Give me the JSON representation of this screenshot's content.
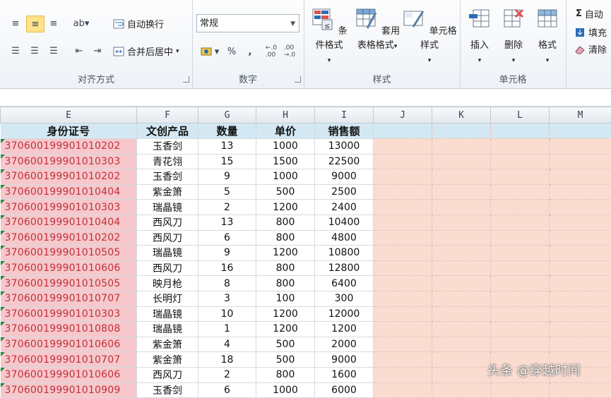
{
  "ribbon": {
    "alignment": {
      "title": "对齐方式",
      "wrap_text": "自动换行",
      "merge_center": "合并后居中"
    },
    "number": {
      "title": "数字",
      "format_value": "常规",
      "percent": "%",
      "comma": ","
    },
    "styles": {
      "title": "样式",
      "conditional": "条件格式",
      "table_format_1": "套用",
      "table_format_2": "表格格式",
      "cell_styles": "单元格样式"
    },
    "cells": {
      "title": "单元格",
      "insert": "插入",
      "delete": "删除",
      "format": "格式"
    },
    "editing": {
      "autosum": "自动",
      "fill": "填充",
      "clear": "清除"
    }
  },
  "columns": [
    "E",
    "F",
    "G",
    "H",
    "I",
    "J",
    "K",
    "L",
    "M"
  ],
  "table": {
    "headers": [
      "身份证号",
      "文创产品",
      "数量",
      "单价",
      "销售额"
    ],
    "rows": [
      [
        "370600199901010202",
        "玉香剑",
        "13",
        "1000",
        "13000"
      ],
      [
        "370600199901010303",
        "青花翎",
        "15",
        "1500",
        "22500"
      ],
      [
        "370600199901010202",
        "玉香剑",
        "9",
        "1000",
        "9000"
      ],
      [
        "370600199901010404",
        "紫金箫",
        "5",
        "500",
        "2500"
      ],
      [
        "370600199901010303",
        "瑞晶镜",
        "2",
        "1200",
        "2400"
      ],
      [
        "370600199901010404",
        "西风刀",
        "13",
        "800",
        "10400"
      ],
      [
        "370600199901010202",
        "西风刀",
        "6",
        "800",
        "4800"
      ],
      [
        "370600199901010505",
        "瑞晶镜",
        "9",
        "1200",
        "10800"
      ],
      [
        "370600199901010606",
        "西风刀",
        "16",
        "800",
        "12800"
      ],
      [
        "370600199901010505",
        "映月枪",
        "8",
        "800",
        "6400"
      ],
      [
        "370600199901010707",
        "长明灯",
        "3",
        "100",
        "300"
      ],
      [
        "370600199901010303",
        "瑞晶镜",
        "10",
        "1200",
        "12000"
      ],
      [
        "370600199901010808",
        "瑞晶镜",
        "1",
        "1200",
        "1200"
      ],
      [
        "370600199901010606",
        "紫金箫",
        "4",
        "500",
        "2000"
      ],
      [
        "370600199901010707",
        "紫金箫",
        "18",
        "500",
        "9000"
      ],
      [
        "370600199901010606",
        "西风刀",
        "2",
        "800",
        "1600"
      ],
      [
        "370600199901010909",
        "玉香剑",
        "6",
        "1000",
        "6000"
      ]
    ]
  },
  "watermark": "头条 @穿越时间",
  "colors": {
    "id_fill": "#f6c8cc",
    "id_text": "#c0303a",
    "header_fill": "#d3e8f2",
    "empty_fill": "#fbdcd0"
  }
}
